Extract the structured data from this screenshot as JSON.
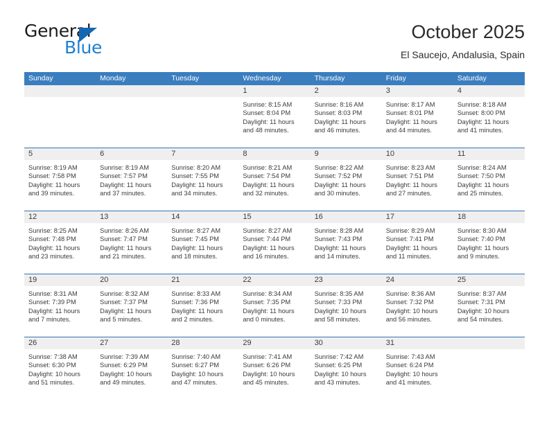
{
  "brand": {
    "name_top": "General",
    "name_bottom": "Blue",
    "accent_color": "#1f7fd0",
    "triangle_color": "#1567b2"
  },
  "header": {
    "title": "October 2025",
    "subtitle": "El Saucejo, Andalusia, Spain"
  },
  "theme": {
    "header_row_bg": "#3a7ebf",
    "week_divider": "#2f74b5",
    "datebar_bg": "#efefef",
    "text": "#3b3b3b"
  },
  "weekdays": [
    "Sunday",
    "Monday",
    "Tuesday",
    "Wednesday",
    "Thursday",
    "Friday",
    "Saturday"
  ],
  "labels": {
    "sunrise_prefix": "Sunrise:",
    "sunset_prefix": "Sunset:",
    "daylight_prefix": "Daylight:"
  },
  "weeks": [
    [
      {
        "day": "",
        "empty": true
      },
      {
        "day": "",
        "empty": true
      },
      {
        "day": "",
        "empty": true
      },
      {
        "day": "1",
        "sunrise": "Sunrise: 8:15 AM",
        "sunset": "Sunset: 8:04 PM",
        "daylight_l1": "Daylight: 11 hours",
        "daylight_l2": "and 48 minutes."
      },
      {
        "day": "2",
        "sunrise": "Sunrise: 8:16 AM",
        "sunset": "Sunset: 8:03 PM",
        "daylight_l1": "Daylight: 11 hours",
        "daylight_l2": "and 46 minutes."
      },
      {
        "day": "3",
        "sunrise": "Sunrise: 8:17 AM",
        "sunset": "Sunset: 8:01 PM",
        "daylight_l1": "Daylight: 11 hours",
        "daylight_l2": "and 44 minutes."
      },
      {
        "day": "4",
        "sunrise": "Sunrise: 8:18 AM",
        "sunset": "Sunset: 8:00 PM",
        "daylight_l1": "Daylight: 11 hours",
        "daylight_l2": "and 41 minutes."
      }
    ],
    [
      {
        "day": "5",
        "sunrise": "Sunrise: 8:19 AM",
        "sunset": "Sunset: 7:58 PM",
        "daylight_l1": "Daylight: 11 hours",
        "daylight_l2": "and 39 minutes."
      },
      {
        "day": "6",
        "sunrise": "Sunrise: 8:19 AM",
        "sunset": "Sunset: 7:57 PM",
        "daylight_l1": "Daylight: 11 hours",
        "daylight_l2": "and 37 minutes."
      },
      {
        "day": "7",
        "sunrise": "Sunrise: 8:20 AM",
        "sunset": "Sunset: 7:55 PM",
        "daylight_l1": "Daylight: 11 hours",
        "daylight_l2": "and 34 minutes."
      },
      {
        "day": "8",
        "sunrise": "Sunrise: 8:21 AM",
        "sunset": "Sunset: 7:54 PM",
        "daylight_l1": "Daylight: 11 hours",
        "daylight_l2": "and 32 minutes."
      },
      {
        "day": "9",
        "sunrise": "Sunrise: 8:22 AM",
        "sunset": "Sunset: 7:52 PM",
        "daylight_l1": "Daylight: 11 hours",
        "daylight_l2": "and 30 minutes."
      },
      {
        "day": "10",
        "sunrise": "Sunrise: 8:23 AM",
        "sunset": "Sunset: 7:51 PM",
        "daylight_l1": "Daylight: 11 hours",
        "daylight_l2": "and 27 minutes."
      },
      {
        "day": "11",
        "sunrise": "Sunrise: 8:24 AM",
        "sunset": "Sunset: 7:50 PM",
        "daylight_l1": "Daylight: 11 hours",
        "daylight_l2": "and 25 minutes."
      }
    ],
    [
      {
        "day": "12",
        "sunrise": "Sunrise: 8:25 AM",
        "sunset": "Sunset: 7:48 PM",
        "daylight_l1": "Daylight: 11 hours",
        "daylight_l2": "and 23 minutes."
      },
      {
        "day": "13",
        "sunrise": "Sunrise: 8:26 AM",
        "sunset": "Sunset: 7:47 PM",
        "daylight_l1": "Daylight: 11 hours",
        "daylight_l2": "and 21 minutes."
      },
      {
        "day": "14",
        "sunrise": "Sunrise: 8:27 AM",
        "sunset": "Sunset: 7:45 PM",
        "daylight_l1": "Daylight: 11 hours",
        "daylight_l2": "and 18 minutes."
      },
      {
        "day": "15",
        "sunrise": "Sunrise: 8:27 AM",
        "sunset": "Sunset: 7:44 PM",
        "daylight_l1": "Daylight: 11 hours",
        "daylight_l2": "and 16 minutes."
      },
      {
        "day": "16",
        "sunrise": "Sunrise: 8:28 AM",
        "sunset": "Sunset: 7:43 PM",
        "daylight_l1": "Daylight: 11 hours",
        "daylight_l2": "and 14 minutes."
      },
      {
        "day": "17",
        "sunrise": "Sunrise: 8:29 AM",
        "sunset": "Sunset: 7:41 PM",
        "daylight_l1": "Daylight: 11 hours",
        "daylight_l2": "and 11 minutes."
      },
      {
        "day": "18",
        "sunrise": "Sunrise: 8:30 AM",
        "sunset": "Sunset: 7:40 PM",
        "daylight_l1": "Daylight: 11 hours",
        "daylight_l2": "and 9 minutes."
      }
    ],
    [
      {
        "day": "19",
        "sunrise": "Sunrise: 8:31 AM",
        "sunset": "Sunset: 7:39 PM",
        "daylight_l1": "Daylight: 11 hours",
        "daylight_l2": "and 7 minutes."
      },
      {
        "day": "20",
        "sunrise": "Sunrise: 8:32 AM",
        "sunset": "Sunset: 7:37 PM",
        "daylight_l1": "Daylight: 11 hours",
        "daylight_l2": "and 5 minutes."
      },
      {
        "day": "21",
        "sunrise": "Sunrise: 8:33 AM",
        "sunset": "Sunset: 7:36 PM",
        "daylight_l1": "Daylight: 11 hours",
        "daylight_l2": "and 2 minutes."
      },
      {
        "day": "22",
        "sunrise": "Sunrise: 8:34 AM",
        "sunset": "Sunset: 7:35 PM",
        "daylight_l1": "Daylight: 11 hours",
        "daylight_l2": "and 0 minutes."
      },
      {
        "day": "23",
        "sunrise": "Sunrise: 8:35 AM",
        "sunset": "Sunset: 7:33 PM",
        "daylight_l1": "Daylight: 10 hours",
        "daylight_l2": "and 58 minutes."
      },
      {
        "day": "24",
        "sunrise": "Sunrise: 8:36 AM",
        "sunset": "Sunset: 7:32 PM",
        "daylight_l1": "Daylight: 10 hours",
        "daylight_l2": "and 56 minutes."
      },
      {
        "day": "25",
        "sunrise": "Sunrise: 8:37 AM",
        "sunset": "Sunset: 7:31 PM",
        "daylight_l1": "Daylight: 10 hours",
        "daylight_l2": "and 54 minutes."
      }
    ],
    [
      {
        "day": "26",
        "sunrise": "Sunrise: 7:38 AM",
        "sunset": "Sunset: 6:30 PM",
        "daylight_l1": "Daylight: 10 hours",
        "daylight_l2": "and 51 minutes."
      },
      {
        "day": "27",
        "sunrise": "Sunrise: 7:39 AM",
        "sunset": "Sunset: 6:29 PM",
        "daylight_l1": "Daylight: 10 hours",
        "daylight_l2": "and 49 minutes."
      },
      {
        "day": "28",
        "sunrise": "Sunrise: 7:40 AM",
        "sunset": "Sunset: 6:27 PM",
        "daylight_l1": "Daylight: 10 hours",
        "daylight_l2": "and 47 minutes."
      },
      {
        "day": "29",
        "sunrise": "Sunrise: 7:41 AM",
        "sunset": "Sunset: 6:26 PM",
        "daylight_l1": "Daylight: 10 hours",
        "daylight_l2": "and 45 minutes."
      },
      {
        "day": "30",
        "sunrise": "Sunrise: 7:42 AM",
        "sunset": "Sunset: 6:25 PM",
        "daylight_l1": "Daylight: 10 hours",
        "daylight_l2": "and 43 minutes."
      },
      {
        "day": "31",
        "sunrise": "Sunrise: 7:43 AM",
        "sunset": "Sunset: 6:24 PM",
        "daylight_l1": "Daylight: 10 hours",
        "daylight_l2": "and 41 minutes."
      },
      {
        "day": "",
        "empty": true
      }
    ]
  ]
}
